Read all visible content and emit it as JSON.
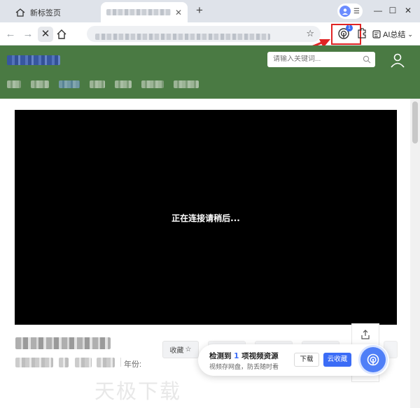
{
  "browser": {
    "tabs": [
      {
        "label": "新标签页",
        "active": false
      },
      {
        "label": "",
        "active": true
      }
    ],
    "new_tab_symbol": "+",
    "close_tab_symbol": "✕",
    "window_controls": {
      "minimize": "—",
      "maximize": "☐",
      "close": "✕"
    },
    "nav": {
      "back": "←",
      "forward": "→",
      "stop": "✕"
    },
    "extension_badge": "1",
    "ai_summary_label": "AI总结",
    "icons": [
      "home-icon",
      "profile-avatar-icon",
      "menu-icon",
      "star-icon",
      "video-sniffer-icon",
      "puzzle-icon",
      "ai-summary-icon"
    ]
  },
  "site": {
    "search_placeholder": "请输入关键词...",
    "icons": [
      "search-icon",
      "user-icon"
    ]
  },
  "video": {
    "status_text": "正在连接请稍后..."
  },
  "details": {
    "year_label": "年份:",
    "favorite_label": "收藏",
    "favorite_icon": "☆"
  },
  "watermark": "天极下载",
  "detect_popup": {
    "title_prefix": "检测到 ",
    "count": "1",
    "title_suffix": " 项视频资源",
    "subtitle": "视频存网盘，防丢随时看",
    "download_label": "下载",
    "cloud_save_label": "云收藏"
  },
  "colors": {
    "header_green": "#4a7a43",
    "accent_blue": "#3b6cf6",
    "highlight_red": "#e02424"
  }
}
